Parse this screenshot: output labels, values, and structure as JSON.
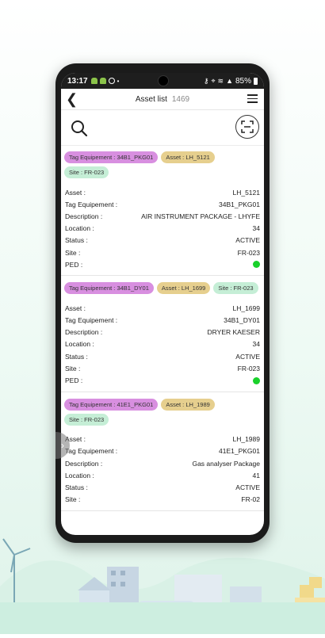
{
  "status_bar": {
    "time": "13:17",
    "battery": "85%"
  },
  "header": {
    "title": "Asset list",
    "count": "1469"
  },
  "labels": {
    "asset": "Asset :",
    "tag": "Tag Equipement :",
    "description": "Description :",
    "location": "Location :",
    "status": "Status :",
    "site": "Site :",
    "ped": "PED :"
  },
  "cards": [
    {
      "chip_tag": "Tag Equipement : 34B1_PKG01",
      "chip_asset": "Asset : LH_5121",
      "chip_site": "Site : FR-023",
      "asset": "LH_5121",
      "tag": "34B1_PKG01",
      "description": "AIR INSTRUMENT PACKAGE - LHYFE",
      "location": "34",
      "status": "ACTIVE",
      "site": "FR-023"
    },
    {
      "chip_tag": "Tag Equipement : 34B1_DY01",
      "chip_asset": "Asset : LH_1699",
      "chip_site": "Site : FR-023",
      "asset": "LH_1699",
      "tag": "34B1_DY01",
      "description": "DRYER KAESER",
      "location": "34",
      "status": "ACTIVE",
      "site": "FR-023"
    },
    {
      "chip_tag": "Tag Equipement : 41E1_PKG01",
      "chip_asset": "Asset : LH_1989",
      "chip_site": "Site : FR-023",
      "asset": "LH_1989",
      "tag": "41E1_PKG01",
      "description": "Gas analyser Package",
      "location": "41",
      "status": "ACTIVE",
      "site": "FR-02"
    }
  ],
  "colors": {
    "ped_ok": "#19d12b",
    "chip_tag": "#d88fe0",
    "chip_asset": "#e6cf8e",
    "chip_site": "#c5eed6"
  },
  "icons": [
    "back-arrow-icon",
    "menu-icon",
    "search-icon",
    "scan-icon",
    "chevron-right-icon"
  ]
}
